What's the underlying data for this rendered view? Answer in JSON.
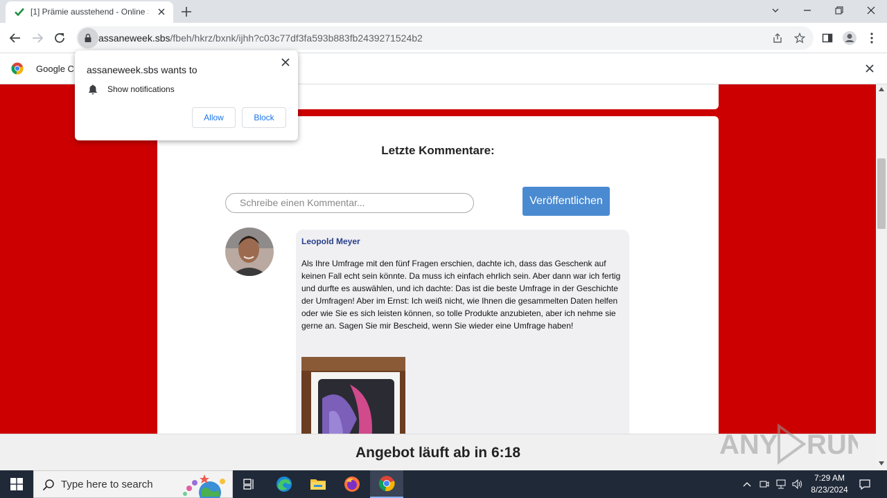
{
  "browser": {
    "tab_title": "[1] Prämie ausstehend - Online S",
    "url_domain": "assaneweek.sbs",
    "url_path": "/fbeh/hkrz/bxnk/ijhh?c03c77df3fa593b883fb2439271524b2",
    "infobar_text": "Google C"
  },
  "popup": {
    "title": "assaneweek.sbs wants to",
    "permission": "Show notifications",
    "allow_label": "Allow",
    "block_label": "Block"
  },
  "page": {
    "comments_heading": "Letzte Kommentare:",
    "comment_placeholder": "Schreibe einen Kommentar...",
    "publish_label": "Veröffentlichen",
    "comment": {
      "author": "Leopold Meyer",
      "text": "Als Ihre Umfrage mit den fünf Fragen erschien, dachte ich, dass das Geschenk auf keinen Fall echt sein könnte. Da muss ich einfach ehrlich sein. Aber dann war ich fertig und durfte es auswählen, und ich dachte: Das ist die beste Umfrage in der Geschichte der Umfragen! Aber im Ernst: Ich weiß nicht, wie Ihnen die gesammelten Daten helfen oder wie Sie es sich leisten können, so tolle Produkte anzubieten, aber ich nehme sie gerne an. Sagen Sie mir Bescheid, wenn Sie wieder eine Umfrage haben!"
    },
    "offer_text": "Angebot läuft ab in 6:18",
    "watermark": "ANY RUN"
  },
  "taskbar": {
    "search_placeholder": "Type here to search",
    "time": "7:29 AM",
    "date": "8/23/2024"
  },
  "colors": {
    "page_bg": "#cc0000",
    "publish_button": "#4a8ad1",
    "author_name": "#283f8a"
  }
}
